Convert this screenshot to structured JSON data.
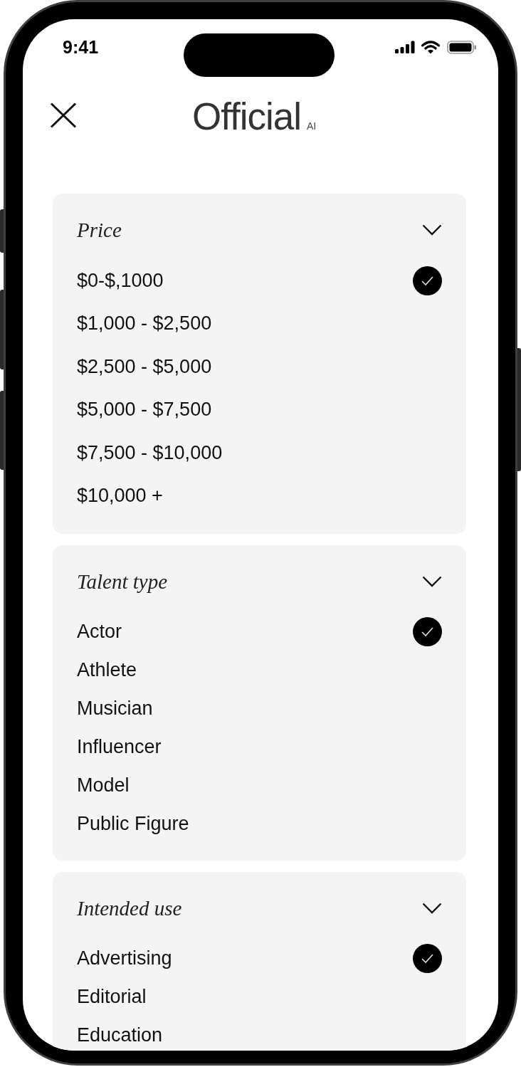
{
  "status_bar": {
    "time": "9:41"
  },
  "header": {
    "logo": "Official",
    "logo_suffix": "AI"
  },
  "filters": [
    {
      "title": "Price",
      "options": [
        {
          "label": "$0-$,1000",
          "selected": true
        },
        {
          "label": "$1,000 - $2,500",
          "selected": false
        },
        {
          "label": "$2,500 - $5,000",
          "selected": false
        },
        {
          "label": "$5,000 - $7,500",
          "selected": false
        },
        {
          "label": "$7,500 - $10,000",
          "selected": false
        },
        {
          "label": "$10,000 +",
          "selected": false
        }
      ]
    },
    {
      "title": "Talent type",
      "options": [
        {
          "label": "Actor",
          "selected": true
        },
        {
          "label": "Athlete",
          "selected": false
        },
        {
          "label": "Musician",
          "selected": false
        },
        {
          "label": "Influencer",
          "selected": false
        },
        {
          "label": "Model",
          "selected": false
        },
        {
          "label": "Public Figure",
          "selected": false
        }
      ]
    },
    {
      "title": "Intended use",
      "options": [
        {
          "label": "Advertising",
          "selected": true
        },
        {
          "label": "Editorial",
          "selected": false
        },
        {
          "label": "Education",
          "selected": false
        }
      ]
    }
  ]
}
